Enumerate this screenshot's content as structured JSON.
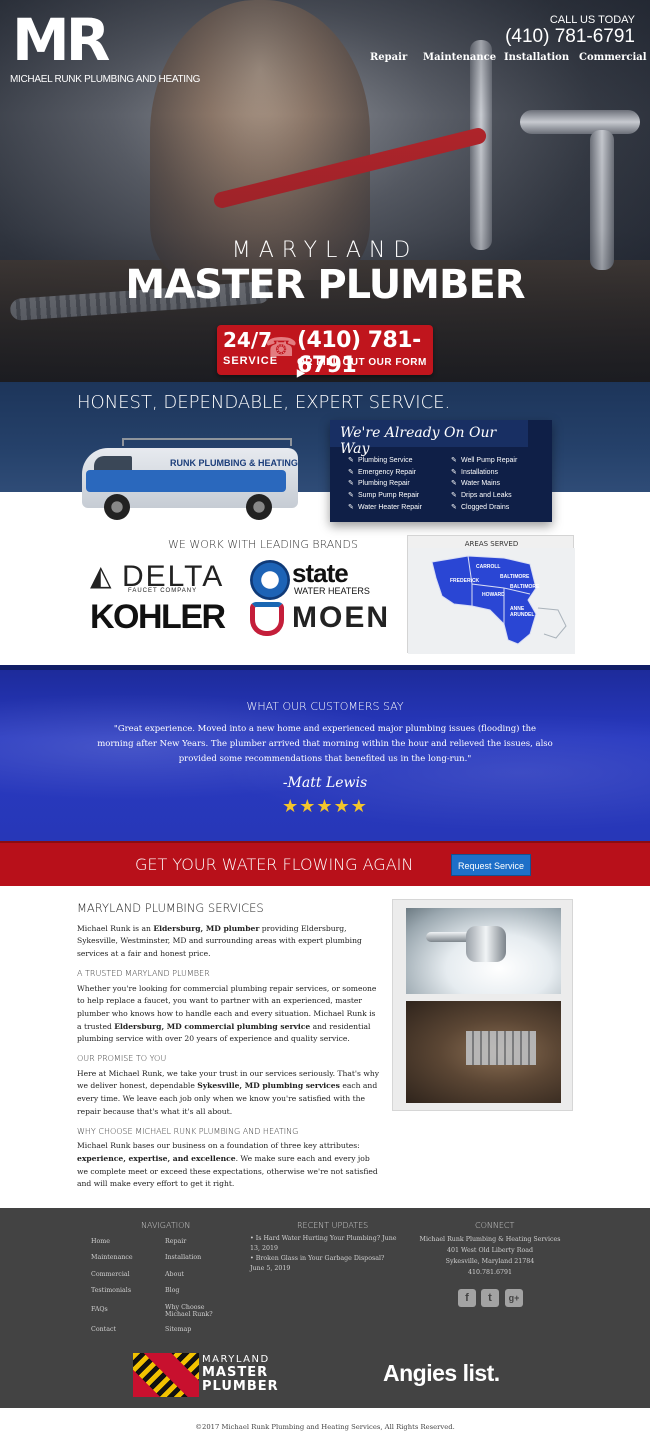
{
  "header": {
    "logo_mark": "MR",
    "logo_tagline": "MICHAEL RUNK PLUMBING AND HEATING",
    "call_label": "CALL US TODAY",
    "call_phone": "(410) 781-6791",
    "nav": [
      "Repair",
      "Maintenance",
      "Installation",
      "Commercial"
    ]
  },
  "hero": {
    "eyebrow": "MARYLAND",
    "title": "MASTER PLUMBER",
    "cta_top": "24/7",
    "cta_service": "SERVICE",
    "cta_phone": "(410) 781-6791",
    "cta_form": "OR FILL OUT OUR FORM ▶"
  },
  "honest": {
    "heading": "HONEST, DEPENDABLE, EXPERT SERVICE.",
    "van_brand": "RUNK PLUMBING & HEATING",
    "on_way_title": "We're Already On Our Way",
    "services_left": [
      "Plumbing Service",
      "Emergency Repair",
      "Plumbing Repair",
      "Sump Pump Repair",
      "Water Heater Repair"
    ],
    "services_right": [
      "Well Pump Repair",
      "Installations",
      "Water Mains",
      "Drips and Leaks",
      "Clogged Drains"
    ]
  },
  "brands": {
    "heading": "WE WORK WITH LEADING BRANDS",
    "delta": "DELTA",
    "delta_sub": "FAUCET COMPANY",
    "state": "state",
    "state_sub": "WATER HEATERS",
    "kohler": "KOHLER",
    "moen": "MOEN"
  },
  "areas": {
    "heading": "AREAS SERVED",
    "labels": [
      "CARROLL",
      "BALTIMORE",
      "FREDERICK",
      "HOWARD",
      "BALTIMORE",
      "ANNE ARUNDEL"
    ]
  },
  "testimonial": {
    "heading": "WHAT OUR CUSTOMERS SAY",
    "quote": "\"Great experience. Moved into a new home and experienced major plumbing issues (flooding) the morning after New Years. The plumber arrived that morning within the hour and relieved the issues, also provided some recommendations that benefited us in the long-run.\"",
    "author": "-Matt Lewis",
    "stars": "★★★★★"
  },
  "red_band": {
    "heading": "GET YOUR WATER FLOWING AGAIN",
    "button": "Request Service"
  },
  "content": {
    "title": "MARYLAND PLUMBING SERVICES",
    "p1_a": "Michael Runk is an ",
    "p1_b": "Eldersburg, MD plumber",
    "p1_c": " providing Eldersburg, Sykesville, Westminster, MD and surrounding areas with expert plumbing services at a fair and honest price.",
    "h2": "A TRUSTED MARYLAND PLUMBER",
    "p2_a": "Whether you're looking for commercial plumbing repair services, or someone to help replace a faucet, you want to partner with an experienced, master plumber who knows how to handle each and every situation. Michael Runk is a trusted ",
    "p2_b": "Eldersburg, MD commercial plumbing service",
    "p2_c": " and residential plumbing service with over 20 years of experience and quality service.",
    "h3": "OUR PROMISE TO YOU",
    "p3_a": "Here at Michael Runk, we take your trust in our services seriously. That's why we deliver honest, dependable ",
    "p3_b": "Sykesville, MD plumbing services",
    "p3_c": " each and every time. We leave each job only when we know you're satisfied with the repair because that's what it's all about.",
    "h4": "WHY CHOOSE MICHAEL RUNK PLUMBING AND HEATING",
    "p4_a": "Michael Runk bases our business on a foundation of three key attributes: ",
    "p4_b": "experience, expertise, and excellence",
    "p4_c": ". We make sure each and every job we complete meet or exceed these expectations, otherwise we're not satisfied and will make every effort to get it right."
  },
  "footer": {
    "nav_heading": "NAVIGATION",
    "nav_col1": [
      "Home",
      "Maintenance",
      "Commercial",
      "Testimonials",
      "FAQs",
      "Contact"
    ],
    "nav_col2": [
      "Repair",
      "Installation",
      "About",
      "Blog",
      "Why Choose Michael Runk?",
      "Sitemap"
    ],
    "updates_heading": "RECENT UPDATES",
    "updates": [
      "Is Hard Water Hurting Your Plumbing? June 13, 2019",
      "Broken Glass in Your Garbage Disposal? June 5, 2019"
    ],
    "connect_heading": "CONNECT",
    "connect_lines": [
      "Michael Runk Plumbing & Heating Services",
      "401 West Old Liberty Road",
      "Sykesville, Maryland 21784",
      "410.781.6791"
    ],
    "social": [
      "f",
      "t",
      "g+"
    ],
    "badge_line1": "MARYLAND",
    "badge_line2": "MASTER",
    "badge_line3": "PLUMBER",
    "angies": "Angies list.",
    "copyright": "©2017 Michael Runk Plumbing and Heating Services, All Rights Reserved."
  },
  "colors": {
    "accent_red": "#b8101a",
    "navy": "#1d355a",
    "testimonial_blue": "#2839c0",
    "button_blue": "#1e6fc8",
    "star_gold": "#f2c42c",
    "footer_gray": "#434343"
  }
}
